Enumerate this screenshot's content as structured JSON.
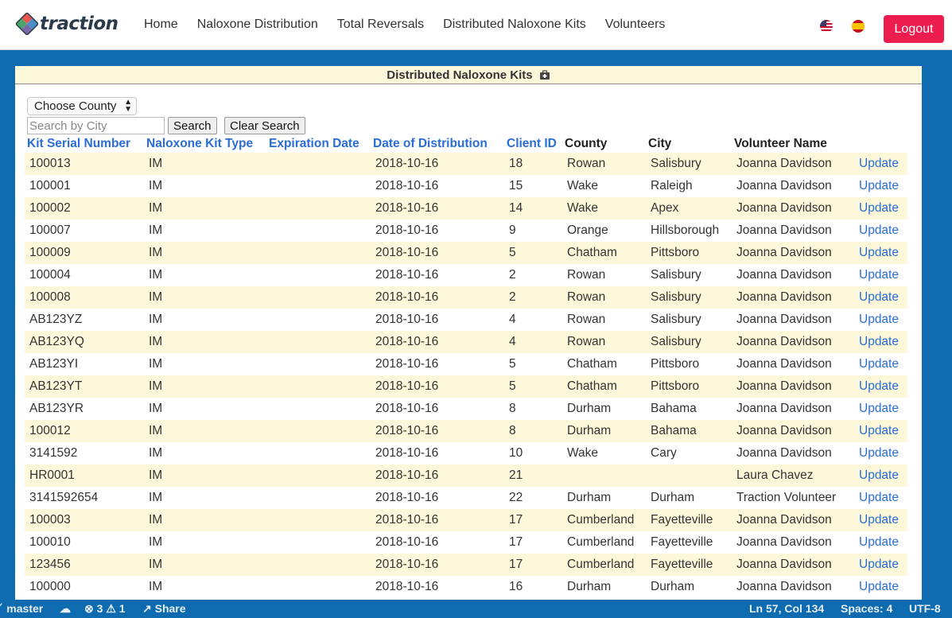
{
  "nav": {
    "brand": "traction",
    "links": [
      "Home",
      "Naloxone Distribution",
      "Total Reversals",
      "Distributed Naloxone Kits",
      "Volunteers"
    ],
    "logout_label": "Logout"
  },
  "panel": {
    "title": "Distributed Naloxone Kits",
    "county_select": "Choose County",
    "search_placeholder": "Search by City",
    "search_label": "Search",
    "clear_label": "Clear Search"
  },
  "table": {
    "headers": [
      "Kit Serial Number",
      "Naloxone Kit Type",
      "Expiration Date",
      "Date of Distribution",
      "Client ID",
      "County",
      "City",
      "Volunteer Name"
    ],
    "rows": [
      {
        "serial": "100013",
        "type": "IM",
        "exp": "",
        "date": "2018-10-16",
        "client": "18",
        "county": "Rowan",
        "city": "Salisbury",
        "volunteer": "Joanna Davidson",
        "action": "Update"
      },
      {
        "serial": "100001",
        "type": "IM",
        "exp": "",
        "date": "2018-10-16",
        "client": "15",
        "county": "Wake",
        "city": "Raleigh",
        "volunteer": "Joanna Davidson",
        "action": "Update"
      },
      {
        "serial": "100002",
        "type": "IM",
        "exp": "",
        "date": "2018-10-16",
        "client": "14",
        "county": "Wake",
        "city": "Apex",
        "volunteer": "Joanna Davidson",
        "action": "Update"
      },
      {
        "serial": "100007",
        "type": "IM",
        "exp": "",
        "date": "2018-10-16",
        "client": "9",
        "county": "Orange",
        "city": "Hillsborough",
        "volunteer": "Joanna Davidson",
        "action": "Update"
      },
      {
        "serial": "100009",
        "type": "IM",
        "exp": "",
        "date": "2018-10-16",
        "client": "5",
        "county": "Chatham",
        "city": "Pittsboro",
        "volunteer": "Joanna Davidson",
        "action": "Update"
      },
      {
        "serial": "100004",
        "type": "IM",
        "exp": "",
        "date": "2018-10-16",
        "client": "2",
        "county": "Rowan",
        "city": "Salisbury",
        "volunteer": "Joanna Davidson",
        "action": "Update"
      },
      {
        "serial": "100008",
        "type": "IM",
        "exp": "",
        "date": "2018-10-16",
        "client": "2",
        "county": "Rowan",
        "city": "Salisbury",
        "volunteer": "Joanna Davidson",
        "action": "Update"
      },
      {
        "serial": "AB123YZ",
        "type": "IM",
        "exp": "",
        "date": "2018-10-16",
        "client": "4",
        "county": "Rowan",
        "city": "Salisbury",
        "volunteer": "Joanna Davidson",
        "action": "Update"
      },
      {
        "serial": "AB123YQ",
        "type": "IM",
        "exp": "",
        "date": "2018-10-16",
        "client": "4",
        "county": "Rowan",
        "city": "Salisbury",
        "volunteer": "Joanna Davidson",
        "action": "Update"
      },
      {
        "serial": "AB123YI",
        "type": "IM",
        "exp": "",
        "date": "2018-10-16",
        "client": "5",
        "county": "Chatham",
        "city": "Pittsboro",
        "volunteer": "Joanna Davidson",
        "action": "Update"
      },
      {
        "serial": "AB123YT",
        "type": "IM",
        "exp": "",
        "date": "2018-10-16",
        "client": "5",
        "county": "Chatham",
        "city": "Pittsboro",
        "volunteer": "Joanna Davidson",
        "action": "Update"
      },
      {
        "serial": "AB123YR",
        "type": "IM",
        "exp": "",
        "date": "2018-10-16",
        "client": "8",
        "county": "Durham",
        "city": "Bahama",
        "volunteer": "Joanna Davidson",
        "action": "Update"
      },
      {
        "serial": "100012",
        "type": "IM",
        "exp": "",
        "date": "2018-10-16",
        "client": "8",
        "county": "Durham",
        "city": "Bahama",
        "volunteer": "Joanna Davidson",
        "action": "Update"
      },
      {
        "serial": "3141592",
        "type": "IM",
        "exp": "",
        "date": "2018-10-16",
        "client": "10",
        "county": "Wake",
        "city": "Cary",
        "volunteer": "Joanna Davidson",
        "action": "Update"
      },
      {
        "serial": "HR0001",
        "type": "IM",
        "exp": "",
        "date": "2018-10-16",
        "client": "21",
        "county": "",
        "city": "",
        "volunteer": "Laura Chavez",
        "action": "Update"
      },
      {
        "serial": "3141592654",
        "type": "IM",
        "exp": "",
        "date": "2018-10-16",
        "client": "22",
        "county": "Durham",
        "city": "Durham",
        "volunteer": "Traction Volunteer",
        "action": "Update"
      },
      {
        "serial": "100003",
        "type": "IM",
        "exp": "",
        "date": "2018-10-16",
        "client": "17",
        "county": "Cumberland",
        "city": "Fayetteville",
        "volunteer": "Joanna Davidson",
        "action": "Update"
      },
      {
        "serial": "100010",
        "type": "IM",
        "exp": "",
        "date": "2018-10-16",
        "client": "17",
        "county": "Cumberland",
        "city": "Fayetteville",
        "volunteer": "Joanna Davidson",
        "action": "Update"
      },
      {
        "serial": "123456",
        "type": "IM",
        "exp": "",
        "date": "2018-10-16",
        "client": "17",
        "county": "Cumberland",
        "city": "Fayetteville",
        "volunteer": "Joanna Davidson",
        "action": "Update"
      },
      {
        "serial": "100000",
        "type": "IM",
        "exp": "",
        "date": "2018-10-16",
        "client": "16",
        "county": "Durham",
        "city": "Durham",
        "volunteer": "Joanna Davidson",
        "action": "Update"
      }
    ]
  },
  "statusbar": {
    "branch": "master",
    "errors": "3",
    "warnings": "1",
    "share": "Share",
    "position": "Ln 57, Col 134",
    "spaces": "Spaces: 4",
    "encoding": "UTF-8"
  },
  "colors": {
    "accent": "#ee1d4f",
    "link": "#2a6dd8",
    "background": "#0e6bb0",
    "row_stripe": "#fcf8d9"
  }
}
